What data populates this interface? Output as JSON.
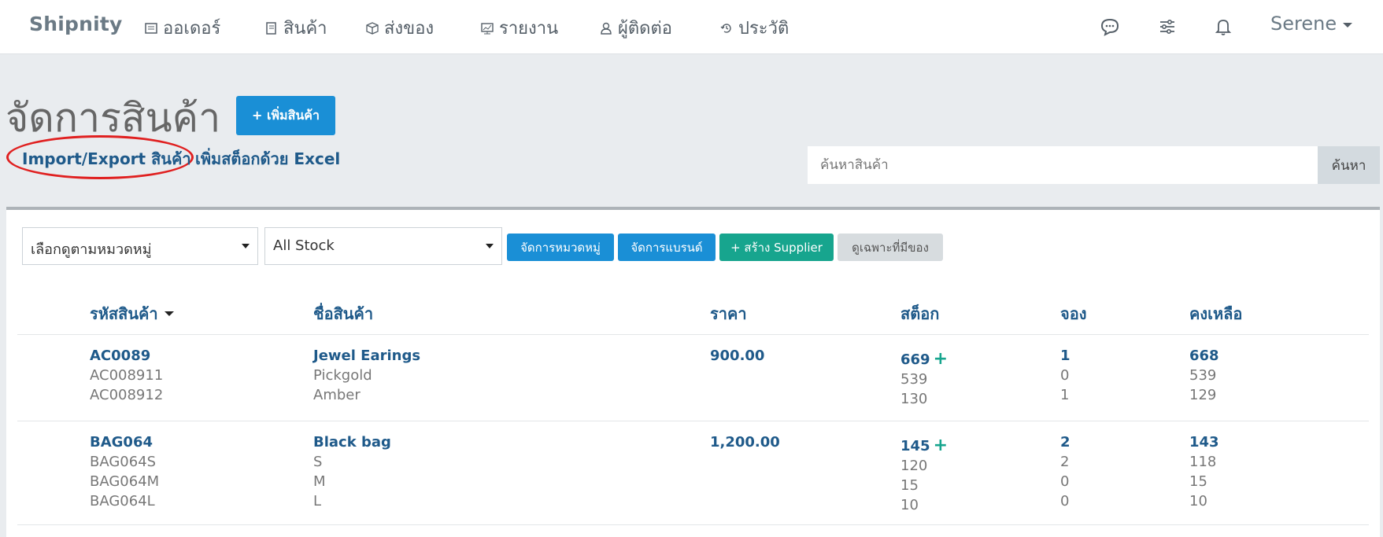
{
  "nav": {
    "brand": "Shipnity",
    "items": [
      {
        "label": "ออเดอร์",
        "icon": "receipt-icon"
      },
      {
        "label": "สินค้า",
        "icon": "product-icon"
      },
      {
        "label": "ส่งของ",
        "icon": "box-icon"
      },
      {
        "label": "รายงาน",
        "icon": "report-icon"
      },
      {
        "label": "ผู้ติดต่อ",
        "icon": "user-icon"
      },
      {
        "label": "ประวัติ",
        "icon": "history-icon"
      }
    ],
    "right_icons": [
      "chat-icon",
      "sliders-icon",
      "bell-icon"
    ],
    "user": "Serene"
  },
  "header": {
    "title": "จัดการสินค้า",
    "add_button": "+ เพิ่มสินค้า",
    "import_link": "Import/Export สินค้า",
    "excel_link": "เพิ่มสต็อกด้วย Excel",
    "search_placeholder": "ค้นหาสินค้า",
    "search_button": "ค้นหา"
  },
  "toolbar": {
    "category_select": "เลือกดูตามหมวดหมู่",
    "stock_select": "All Stock",
    "manage_category": "จัดการหมวดหมู่",
    "manage_brand": "จัดการแบรนด์",
    "create_supplier": "+ สร้าง Supplier",
    "in_stock_only": "ดูเฉพาะที่มีของ"
  },
  "table": {
    "headers": [
      "รหัสสินค้า",
      "ชื่อสินค้า",
      "ราคา",
      "สต็อก",
      "จอง",
      "คงเหลือ"
    ],
    "rows": [
      {
        "code": "AC0089",
        "sub_codes": [
          "AC008911",
          "AC008912"
        ],
        "name": "Jewel Earings",
        "variants": [
          "Pickgold",
          "Amber"
        ],
        "price": "900.00",
        "stock": "669",
        "stock_variants": [
          "539",
          "130"
        ],
        "reserved": "1",
        "reserved_variants": [
          "0",
          "1"
        ],
        "remaining": "668",
        "remaining_variants": [
          "539",
          "129"
        ]
      },
      {
        "code": "BAG064",
        "sub_codes": [
          "BAG064S",
          "BAG064M",
          "BAG064L"
        ],
        "name": "Black bag",
        "variants": [
          "S",
          "M",
          "L"
        ],
        "price": "1,200.00",
        "stock": "145",
        "stock_variants": [
          "120",
          "15",
          "10"
        ],
        "reserved": "2",
        "reserved_variants": [
          "2",
          "0",
          "0"
        ],
        "remaining": "143",
        "remaining_variants": [
          "118",
          "15",
          "10"
        ]
      }
    ]
  }
}
